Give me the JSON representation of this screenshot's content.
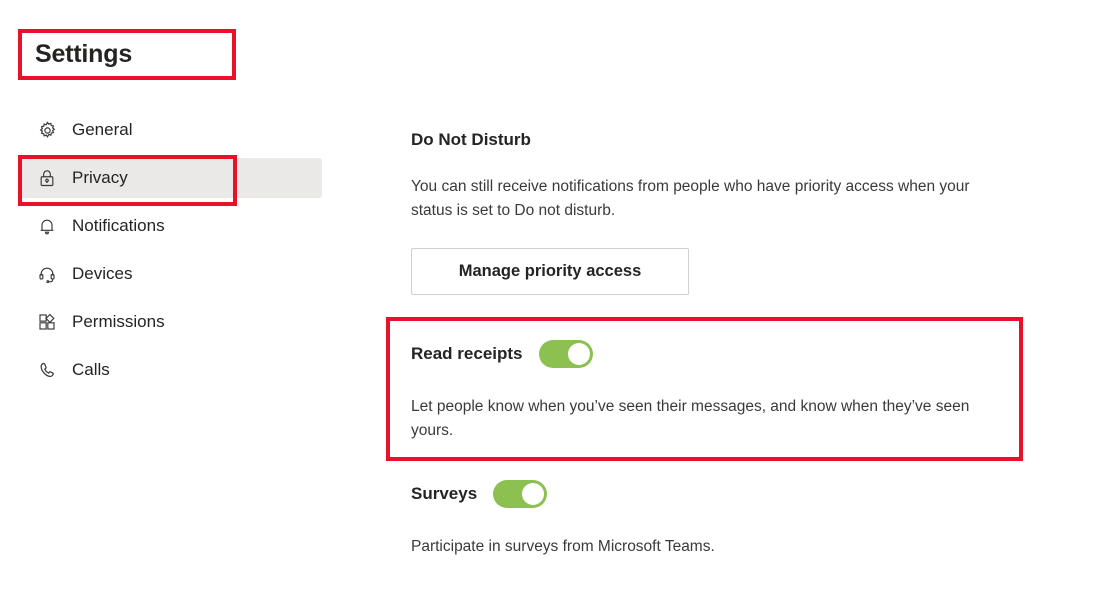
{
  "header": {
    "title": "Settings"
  },
  "sidebar": {
    "items": [
      {
        "label": "General",
        "icon": "gear-icon",
        "selected": false
      },
      {
        "label": "Privacy",
        "icon": "lock-icon",
        "selected": true
      },
      {
        "label": "Notifications",
        "icon": "bell-icon",
        "selected": false
      },
      {
        "label": "Devices",
        "icon": "headset-icon",
        "selected": false
      },
      {
        "label": "Permissions",
        "icon": "app-grid-icon",
        "selected": false
      },
      {
        "label": "Calls",
        "icon": "phone-icon",
        "selected": false
      }
    ]
  },
  "main": {
    "do_not_disturb": {
      "heading": "Do Not Disturb",
      "description": "You can still receive notifications from people who have priority access when your status is set to Do not disturb.",
      "button_label": "Manage priority access"
    },
    "read_receipts": {
      "heading": "Read receipts",
      "description": "Let people know when you’ve seen their messages, and know when they’ve seen yours.",
      "toggle_state": "on"
    },
    "surveys": {
      "heading": "Surveys",
      "description": "Participate in surveys from Microsoft Teams.",
      "toggle_state": "on"
    }
  },
  "annotations": {
    "color": "#e8112a",
    "targets": [
      "Settings",
      "Privacy",
      "Read receipts"
    ]
  },
  "colors": {
    "toggle_on": "#8cc152",
    "selected_row": "#ebe9e7",
    "annotation_red": "#e8112a",
    "text_primary": "#252423",
    "text_secondary": "#3b3a39"
  }
}
